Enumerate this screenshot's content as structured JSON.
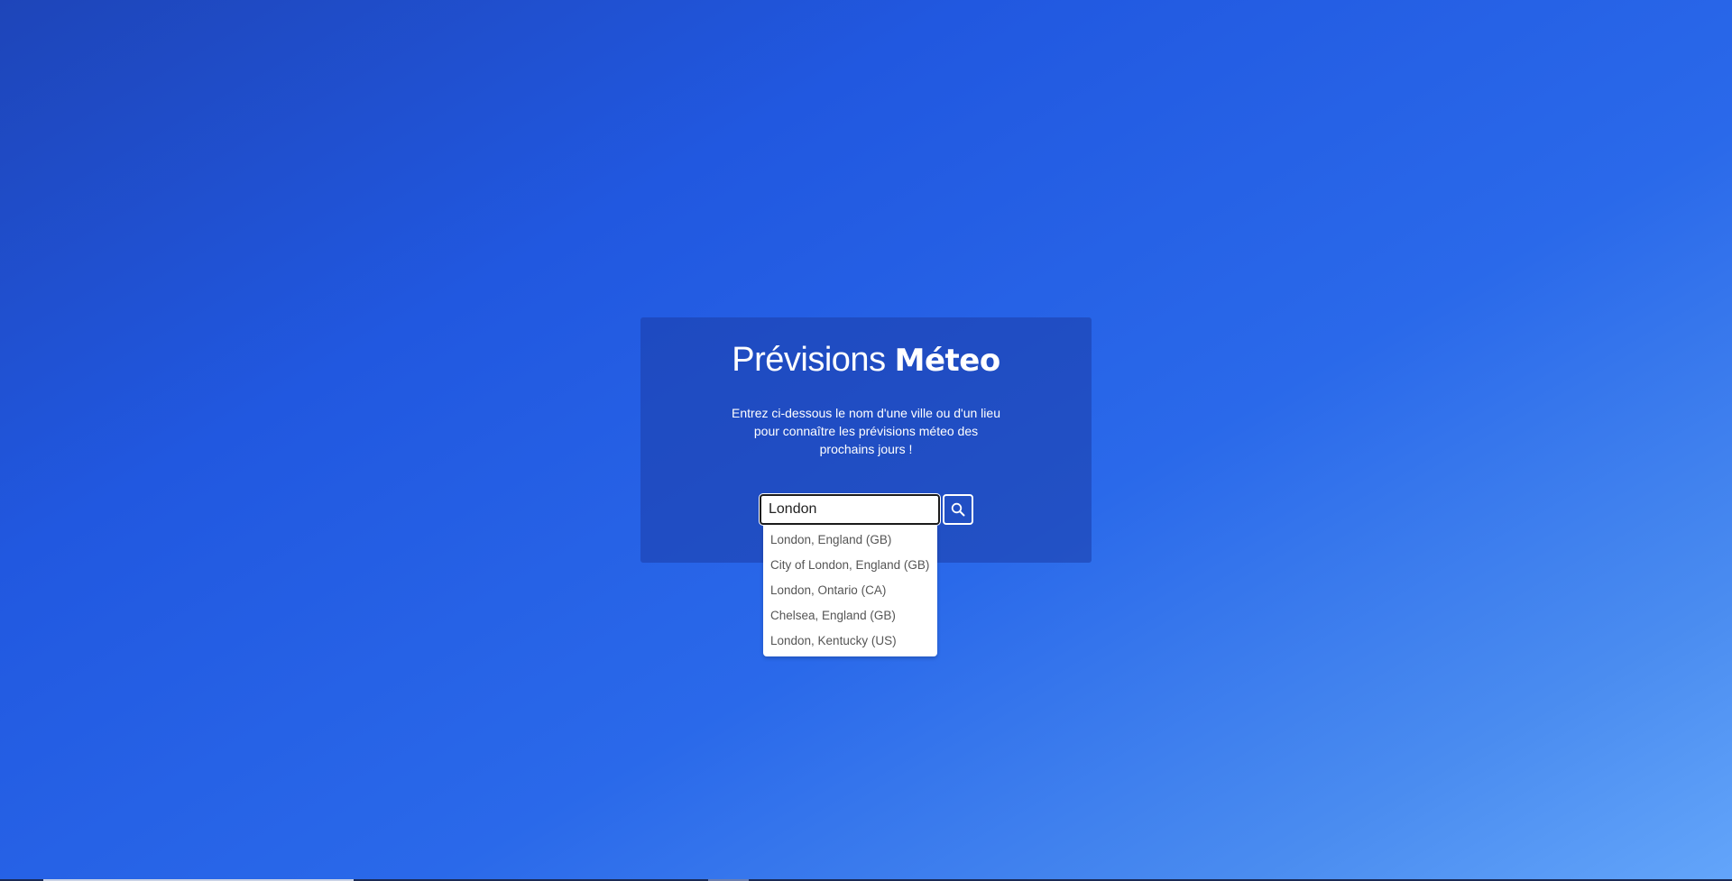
{
  "header": {
    "title_light": "Prévisions",
    "title_bold": "Méteo"
  },
  "intro": {
    "text": "Entrez ci-dessous le nom d'une ville ou d'un lieu pour connaître les prévisions méteo des prochains jours !"
  },
  "search": {
    "value": "London",
    "placeholder": "",
    "button_icon": "search-icon"
  },
  "suggestions": [
    "London, England (GB)",
    "City of London, England (GB)",
    "London, Ontario (CA)",
    "Chelsea, England (GB)",
    "London, Kentucky (US)"
  ],
  "colors": {
    "background_start": "#1e45b9",
    "background_end": "#63a5fa",
    "card": "#1c3ca5",
    "text": "#ffffff",
    "suggestion_text": "#555555"
  }
}
